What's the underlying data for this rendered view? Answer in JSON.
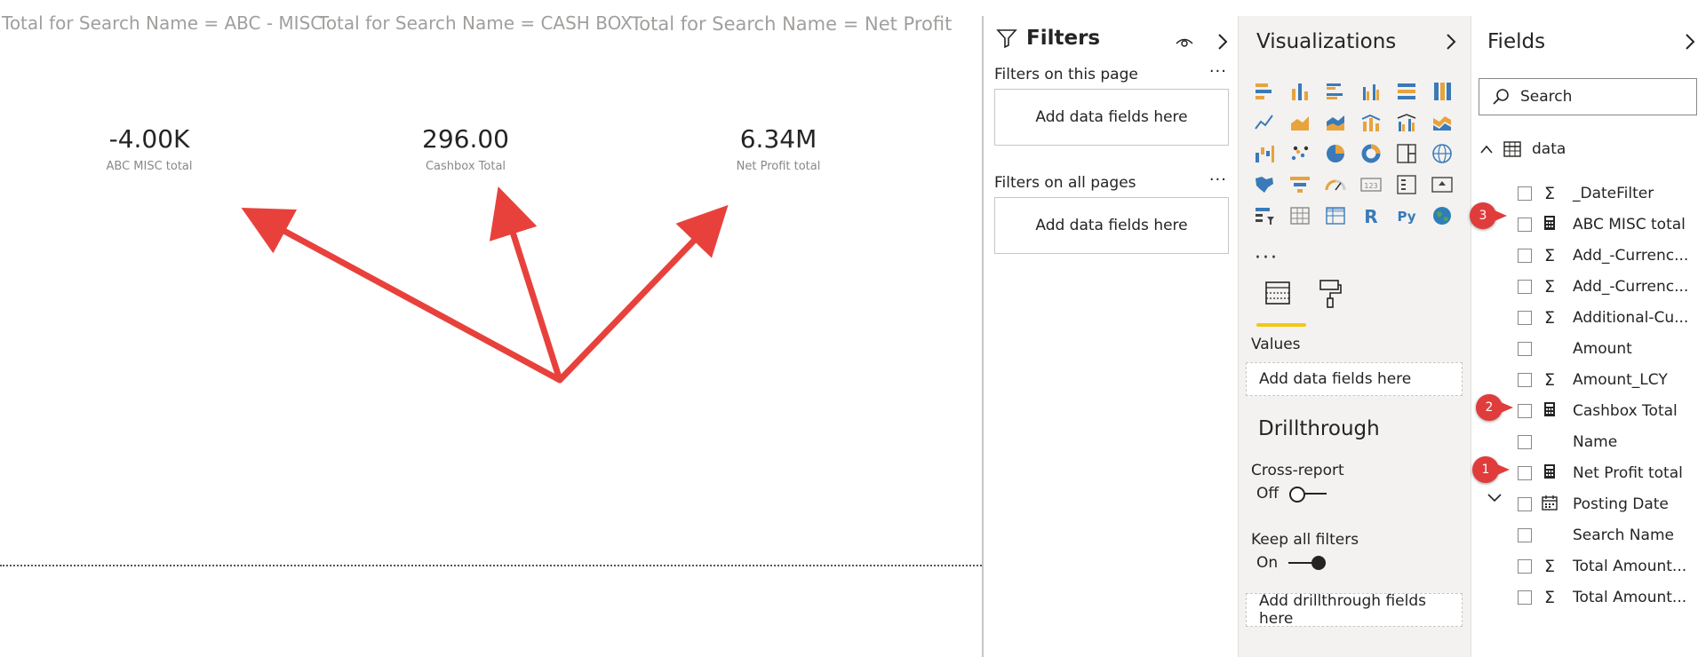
{
  "canvas": {
    "cards": [
      {
        "title": "Total for Search Name = ABC - MISC",
        "value": "-4.00K",
        "label": "ABC MISC total"
      },
      {
        "title": "Total for Search Name = CASH BOX",
        "value": "296.00",
        "label": "Cashbox Total"
      },
      {
        "title": "Total for Search Name = Net Profit",
        "value": "6.34M",
        "label": "Net Profit total"
      }
    ]
  },
  "filters": {
    "title": "Filters",
    "this_page_label": "Filters on this page",
    "all_pages_label": "Filters on all pages",
    "more": "···",
    "dropzone_text": "Add data fields here"
  },
  "visualizations": {
    "title": "Visualizations",
    "more": "···",
    "values_label": "Values",
    "values_dropzone": "Add data fields here",
    "drillthrough_title": "Drillthrough",
    "cross_report_label": "Cross-report",
    "cross_report_state": "Off",
    "keep_filters_label": "Keep all filters",
    "keep_filters_state": "On",
    "drill_dropzone": "Add drillthrough fields here"
  },
  "fields": {
    "title": "Fields",
    "search_placeholder": "Search",
    "table_name": "data",
    "items": [
      {
        "name": "_DateFilter",
        "type": "sigma"
      },
      {
        "name": "ABC MISC total",
        "type": "calc"
      },
      {
        "name": "Add_-Currenc...",
        "type": "sigma"
      },
      {
        "name": "Add_-Currenc...",
        "type": "sigma"
      },
      {
        "name": "Additional-Cu...",
        "type": "sigma"
      },
      {
        "name": "Amount",
        "type": "none"
      },
      {
        "name": "Amount_LCY",
        "type": "sigma"
      },
      {
        "name": "Cashbox Total",
        "type": "calc"
      },
      {
        "name": "Name",
        "type": "none"
      },
      {
        "name": "Net Profit total",
        "type": "calc"
      },
      {
        "name": "Posting Date",
        "type": "calendar"
      },
      {
        "name": "Search Name",
        "type": "none"
      },
      {
        "name": "Total Amount...",
        "type": "sigma"
      },
      {
        "name": "Total Amount...",
        "type": "sigma"
      }
    ]
  },
  "annotations": {
    "badge_3": "3",
    "badge_2": "2",
    "badge_1": "1",
    "arrow_color": "#e8413c"
  }
}
